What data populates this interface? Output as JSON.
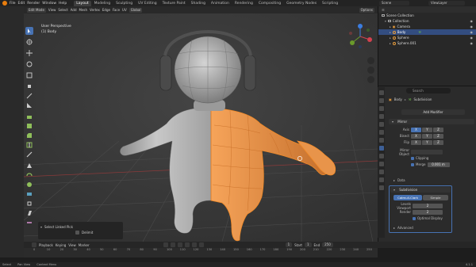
{
  "topbar": {
    "menus": [
      "File",
      "Edit",
      "Render",
      "Window",
      "Help"
    ],
    "tabs": [
      "Layout",
      "Modeling",
      "Sculpting",
      "UV Editing",
      "Texture Paint",
      "Shading",
      "Animation",
      "Rendering",
      "Compositing",
      "Geometry Nodes",
      "Scripting"
    ],
    "active_tab": "Layout",
    "scene": "Scene",
    "view_layer": "ViewLayer"
  },
  "viewport": {
    "header": [
      "Edit Mode",
      "View",
      "Select",
      "Add",
      "Mesh",
      "Vertex",
      "Edge",
      "Face",
      "UV"
    ],
    "transform": "Global",
    "info_line1": "User Perspective",
    "info_line2": "(1) Body",
    "options_label": "Options"
  },
  "operator_panel": {
    "title": "Select Linked Pick",
    "checkbox_label": "Delimit"
  },
  "timeline": {
    "menus": [
      "Playback",
      "Keying",
      "View",
      "Marker"
    ],
    "current_frame": "1",
    "start_label": "Start",
    "start": "1",
    "end_label": "End",
    "end": "250",
    "ticks": [
      "0",
      "10",
      "20",
      "30",
      "40",
      "50",
      "60",
      "70",
      "80",
      "90",
      "100",
      "110",
      "120",
      "130",
      "140",
      "150",
      "160",
      "170",
      "180",
      "190",
      "200",
      "210",
      "220",
      "230",
      "240",
      "250"
    ]
  },
  "outliner": {
    "title": "Scene Collection",
    "rows": [
      {
        "label": "Collection",
        "kind": "collection",
        "selected": false
      },
      {
        "label": "Camera",
        "kind": "object",
        "selected": false
      },
      {
        "label": "Body",
        "kind": "object",
        "selected": true
      },
      {
        "label": "Sphere",
        "kind": "object",
        "selected": false
      },
      {
        "label": "Sphere.001",
        "kind": "object",
        "selected": false
      }
    ]
  },
  "properties": {
    "search_placeholder": "Search",
    "path_object": "Body",
    "path_modifier": "Subdivision",
    "add_modifier": "Add Modifier",
    "modifier1": {
      "name": "Mirror",
      "axis_label": "Axis",
      "bisect_label": "Bisect",
      "flip_label": "Flip",
      "axes": [
        "X",
        "Y",
        "Z"
      ],
      "mirror_object_label": "Mirror Object",
      "clipping_label": "Clipping",
      "merge_label": "Merge",
      "merge_value": "0.001 m",
      "data_label": "Data"
    },
    "modifier2": {
      "name": "Subdivision",
      "mode_catmull": "Catmull-Clark",
      "mode_simple": "Simple",
      "levels_viewport_label": "Levels Viewport",
      "levels_viewport": "2",
      "render_label": "Render",
      "render_value": "2",
      "optimal_display_label": "Optimal Display",
      "advanced_label": "Advanced"
    }
  },
  "statusbar": {
    "items": [
      "Select",
      "Pan View",
      "Context Menu"
    ],
    "version": "4.1.1"
  },
  "colors": {
    "accent": "#e87d0d",
    "selection": "#4772b3",
    "selected_mesh": "#f4a158"
  }
}
